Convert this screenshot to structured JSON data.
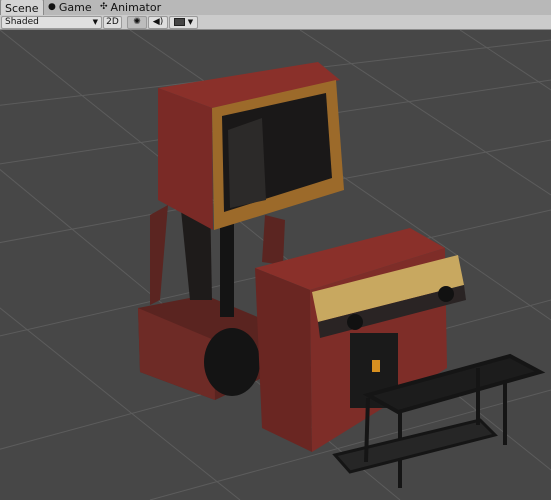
{
  "tabs": [
    {
      "label": "Scene",
      "icon": "scene-icon",
      "active": true
    },
    {
      "label": "Game",
      "icon": "game-controller-icon",
      "active": false
    },
    {
      "label": "Animator",
      "icon": "animator-icon",
      "active": false
    }
  ],
  "toolbar": {
    "shading_mode": "Shaded",
    "mode_2d": "2D",
    "lighting_icon": "sun-icon",
    "audio_icon": "speaker-icon",
    "effects_icon": "image-icon",
    "dropdown_caret_icon": "chevron-down-icon"
  },
  "colors": {
    "cabinet_red": "#7a2a26",
    "cabinet_dark": "#3a1816",
    "grid_line": "#5a5a5a",
    "background": "#474747"
  }
}
